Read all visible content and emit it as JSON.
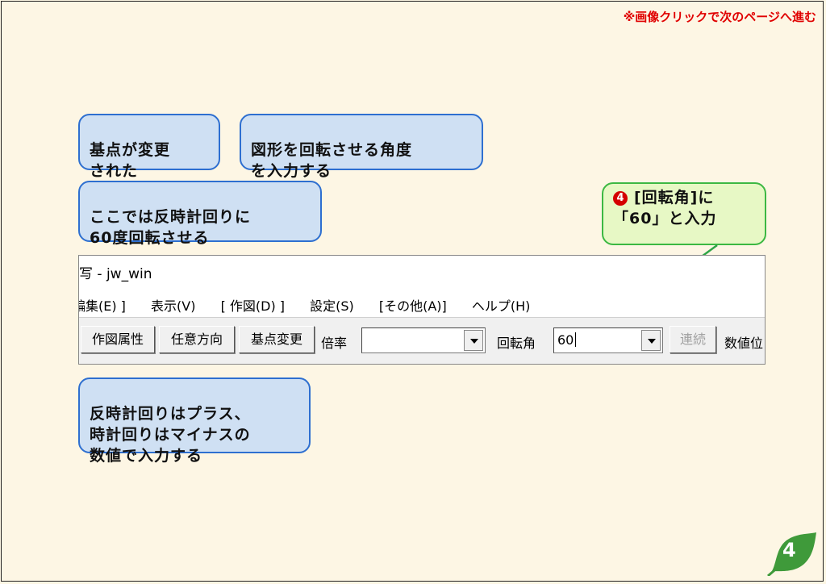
{
  "header_note": "※画像クリックで次のページへ進む",
  "callouts": {
    "base_changed": "基点が変更\nされた",
    "enter_angle": "図形を回転させる角度\nを入力する",
    "rotate_ccw": "ここでは反時計回りに\n60度回転させる",
    "sign_rule": "反時計回りはプラス、\n時計回りはマイナスの\n数値で入力する",
    "step4_badge": "4",
    "step4_line1": "[回転角]に",
    "step4_line2": "「60」と入力"
  },
  "app": {
    "title": "写 - jw_win",
    "menu": [
      "編集(E) ]",
      "表示(V)",
      "[ 作図(D) ]",
      "設定(S)",
      "[その他(A)]",
      "ヘルプ(H)"
    ],
    "toolbar": {
      "btn_draw_attr": "作図属性",
      "btn_any_dir": "任意方向",
      "btn_base_change": "基点変更",
      "label_scale": "倍率",
      "scale_value": "",
      "label_angle": "回転角",
      "angle_value": "60",
      "btn_continuous": "連続",
      "label_numeric": "数値位"
    }
  },
  "page_number": "4",
  "colors": {
    "background": "#fdf6e4",
    "note_red": "#e00000",
    "callout_blue_fill": "#cfe0f3",
    "callout_blue_border": "#2e6fd0",
    "callout_green_fill": "#e7f8c5",
    "callout_green_border": "#3cb843",
    "leaf_green": "#3f9a3a"
  }
}
